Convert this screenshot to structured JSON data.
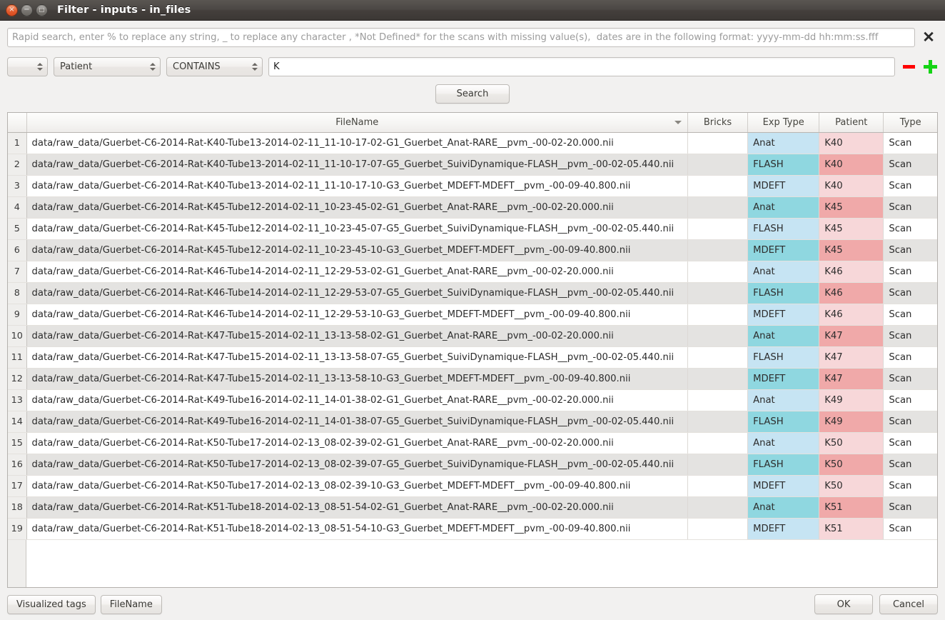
{
  "window": {
    "title": "Filter - inputs - in_files",
    "controls": {
      "close": "×",
      "minimize": "−",
      "maximize": "□"
    }
  },
  "search": {
    "placeholder": "Rapid search, enter % to replace any string, _ to replace any character , *Not Defined* for the scans with missing value(s),  dates are in the following format: yyyy-mm-dd hh:mm:ss.fff",
    "value": "",
    "clear_label": "✕"
  },
  "filter": {
    "link_operator": "",
    "field": "Patient",
    "operator": "CONTAINS",
    "value": "K",
    "remove_label": "−",
    "add_label": "+"
  },
  "actions": {
    "search": "Search",
    "visualized_tags": "Visualized tags",
    "filename": "FileName",
    "ok": "OK",
    "cancel": "Cancel"
  },
  "colors": {
    "exp_type_odd": "#c6e4f3",
    "exp_type_even": "#8fd7e0",
    "patient_odd": "#f7d7d9",
    "patient_even": "#f0a9a9",
    "row_even": "#e4e3e1",
    "row_odd": "#ffffff",
    "minus": "#ff0000",
    "plus": "#14d414",
    "titlebar": "#443f3c"
  },
  "table": {
    "columns": [
      {
        "key": "rownum",
        "label": "",
        "sorted": false
      },
      {
        "key": "filename",
        "label": "FileName",
        "sorted": true,
        "sort_dir": "desc"
      },
      {
        "key": "bricks",
        "label": "Bricks",
        "sorted": false
      },
      {
        "key": "exp",
        "label": "Exp Type",
        "sorted": false
      },
      {
        "key": "patient",
        "label": "Patient",
        "sorted": false
      },
      {
        "key": "type",
        "label": "Type",
        "sorted": false
      }
    ],
    "rows": [
      {
        "rownum": "1",
        "filename": "data/raw_data/Guerbet-C6-2014-Rat-K40-Tube13-2014-02-11_11-10-17-02-G1_Guerbet_Anat-RARE__pvm_-00-02-20.000.nii",
        "bricks": "",
        "exp": "Anat",
        "patient": "K40",
        "type": "Scan"
      },
      {
        "rownum": "2",
        "filename": "data/raw_data/Guerbet-C6-2014-Rat-K40-Tube13-2014-02-11_11-10-17-07-G5_Guerbet_SuiviDynamique-FLASH__pvm_-00-02-05.440.nii",
        "bricks": "",
        "exp": "FLASH",
        "patient": "K40",
        "type": "Scan"
      },
      {
        "rownum": "3",
        "filename": "data/raw_data/Guerbet-C6-2014-Rat-K40-Tube13-2014-02-11_11-10-17-10-G3_Guerbet_MDEFT-MDEFT__pvm_-00-09-40.800.nii",
        "bricks": "",
        "exp": "MDEFT",
        "patient": "K40",
        "type": "Scan"
      },
      {
        "rownum": "4",
        "filename": "data/raw_data/Guerbet-C6-2014-Rat-K45-Tube12-2014-02-11_10-23-45-02-G1_Guerbet_Anat-RARE__pvm_-00-02-20.000.nii",
        "bricks": "",
        "exp": "Anat",
        "patient": "K45",
        "type": "Scan"
      },
      {
        "rownum": "5",
        "filename": "data/raw_data/Guerbet-C6-2014-Rat-K45-Tube12-2014-02-11_10-23-45-07-G5_Guerbet_SuiviDynamique-FLASH__pvm_-00-02-05.440.nii",
        "bricks": "",
        "exp": "FLASH",
        "patient": "K45",
        "type": "Scan"
      },
      {
        "rownum": "6",
        "filename": "data/raw_data/Guerbet-C6-2014-Rat-K45-Tube12-2014-02-11_10-23-45-10-G3_Guerbet_MDEFT-MDEFT__pvm_-00-09-40.800.nii",
        "bricks": "",
        "exp": "MDEFT",
        "patient": "K45",
        "type": "Scan"
      },
      {
        "rownum": "7",
        "filename": "data/raw_data/Guerbet-C6-2014-Rat-K46-Tube14-2014-02-11_12-29-53-02-G1_Guerbet_Anat-RARE__pvm_-00-02-20.000.nii",
        "bricks": "",
        "exp": "Anat",
        "patient": "K46",
        "type": "Scan"
      },
      {
        "rownum": "8",
        "filename": "data/raw_data/Guerbet-C6-2014-Rat-K46-Tube14-2014-02-11_12-29-53-07-G5_Guerbet_SuiviDynamique-FLASH__pvm_-00-02-05.440.nii",
        "bricks": "",
        "exp": "FLASH",
        "patient": "K46",
        "type": "Scan"
      },
      {
        "rownum": "9",
        "filename": "data/raw_data/Guerbet-C6-2014-Rat-K46-Tube14-2014-02-11_12-29-53-10-G3_Guerbet_MDEFT-MDEFT__pvm_-00-09-40.800.nii",
        "bricks": "",
        "exp": "MDEFT",
        "patient": "K46",
        "type": "Scan"
      },
      {
        "rownum": "10",
        "filename": "data/raw_data/Guerbet-C6-2014-Rat-K47-Tube15-2014-02-11_13-13-58-02-G1_Guerbet_Anat-RARE__pvm_-00-02-20.000.nii",
        "bricks": "",
        "exp": "Anat",
        "patient": "K47",
        "type": "Scan"
      },
      {
        "rownum": "11",
        "filename": "data/raw_data/Guerbet-C6-2014-Rat-K47-Tube15-2014-02-11_13-13-58-07-G5_Guerbet_SuiviDynamique-FLASH__pvm_-00-02-05.440.nii",
        "bricks": "",
        "exp": "FLASH",
        "patient": "K47",
        "type": "Scan"
      },
      {
        "rownum": "12",
        "filename": "data/raw_data/Guerbet-C6-2014-Rat-K47-Tube15-2014-02-11_13-13-58-10-G3_Guerbet_MDEFT-MDEFT__pvm_-00-09-40.800.nii",
        "bricks": "",
        "exp": "MDEFT",
        "patient": "K47",
        "type": "Scan"
      },
      {
        "rownum": "13",
        "filename": "data/raw_data/Guerbet-C6-2014-Rat-K49-Tube16-2014-02-11_14-01-38-02-G1_Guerbet_Anat-RARE__pvm_-00-02-20.000.nii",
        "bricks": "",
        "exp": "Anat",
        "patient": "K49",
        "type": "Scan"
      },
      {
        "rownum": "14",
        "filename": "data/raw_data/Guerbet-C6-2014-Rat-K49-Tube16-2014-02-11_14-01-38-07-G5_Guerbet_SuiviDynamique-FLASH__pvm_-00-02-05.440.nii",
        "bricks": "",
        "exp": "FLASH",
        "patient": "K49",
        "type": "Scan"
      },
      {
        "rownum": "15",
        "filename": "data/raw_data/Guerbet-C6-2014-Rat-K50-Tube17-2014-02-13_08-02-39-02-G1_Guerbet_Anat-RARE__pvm_-00-02-20.000.nii",
        "bricks": "",
        "exp": "Anat",
        "patient": "K50",
        "type": "Scan"
      },
      {
        "rownum": "16",
        "filename": "data/raw_data/Guerbet-C6-2014-Rat-K50-Tube17-2014-02-13_08-02-39-07-G5_Guerbet_SuiviDynamique-FLASH__pvm_-00-02-05.440.nii",
        "bricks": "",
        "exp": "FLASH",
        "patient": "K50",
        "type": "Scan"
      },
      {
        "rownum": "17",
        "filename": "data/raw_data/Guerbet-C6-2014-Rat-K50-Tube17-2014-02-13_08-02-39-10-G3_Guerbet_MDEFT-MDEFT__pvm_-00-09-40.800.nii",
        "bricks": "",
        "exp": "MDEFT",
        "patient": "K50",
        "type": "Scan"
      },
      {
        "rownum": "18",
        "filename": "data/raw_data/Guerbet-C6-2014-Rat-K51-Tube18-2014-02-13_08-51-54-02-G1_Guerbet_Anat-RARE__pvm_-00-02-20.000.nii",
        "bricks": "",
        "exp": "Anat",
        "patient": "K51",
        "type": "Scan"
      },
      {
        "rownum": "19",
        "filename": "data/raw_data/Guerbet-C6-2014-Rat-K51-Tube18-2014-02-13_08-51-54-10-G3_Guerbet_MDEFT-MDEFT__pvm_-00-09-40.800.nii",
        "bricks": "",
        "exp": "MDEFT",
        "patient": "K51",
        "type": "Scan"
      }
    ]
  }
}
